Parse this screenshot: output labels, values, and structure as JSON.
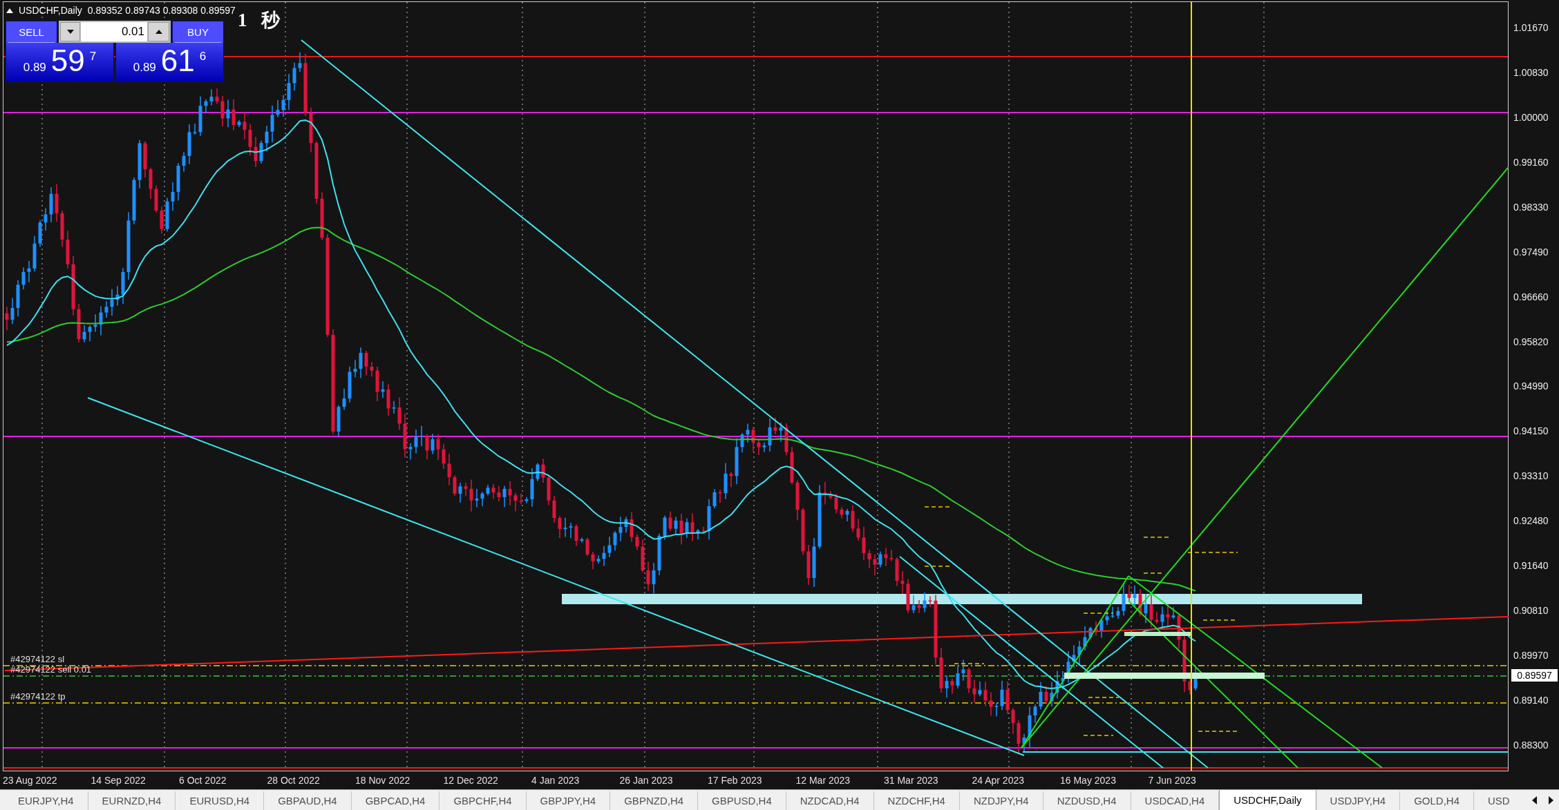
{
  "chart": {
    "symbol": "USDCHF,Daily",
    "quote": "0.89352 0.89743 0.89308 0.89597",
    "timer": "1 秒"
  },
  "one_click_trading": {
    "sell": {
      "label": "SELL",
      "price_prefix": "0.89",
      "price_pips": "59",
      "price_fraction": "7"
    },
    "lot": "0.01",
    "buy": {
      "label": "BUY",
      "price_prefix": "0.89",
      "price_pips": "61",
      "price_fraction": "6"
    }
  },
  "order_lines": [
    {
      "label": "#42974122 sl",
      "kind": "sl"
    },
    {
      "label": "#42974122 sell 0.01",
      "kind": "open"
    },
    {
      "label": "#42974122 tp",
      "kind": "tp"
    }
  ],
  "price_axis": {
    "labels": [
      "1.01670",
      "1.00830",
      "1.00000",
      "0.99160",
      "0.98330",
      "0.97490",
      "0.96660",
      "0.95820",
      "0.94990",
      "0.94150",
      "0.93310",
      "0.92480",
      "0.91640",
      "0.90810",
      "0.89970",
      "0.89140",
      "0.88300"
    ],
    "current_price": "0.89597"
  },
  "time_axis": {
    "labels": [
      "23 Aug 2022",
      "14 Sep 2022",
      "6 Oct 2022",
      "28 Oct 2022",
      "18 Nov 2022",
      "12 Dec 2022",
      "4 Jan 2023",
      "26 Jan 2023",
      "17 Feb 2023",
      "12 Mar 2023",
      "31 Mar 2023",
      "24 Apr 2023",
      "16 May 2023",
      "7 Jun 2023"
    ]
  },
  "tabs": [
    {
      "label": "EURJPY,H4",
      "selected": false
    },
    {
      "label": "EURNZD,H4",
      "selected": false
    },
    {
      "label": "EURUSD,H4",
      "selected": false
    },
    {
      "label": "GBPAUD,H4",
      "selected": false
    },
    {
      "label": "GBPCAD,H4",
      "selected": false
    },
    {
      "label": "GBPCHF,H4",
      "selected": false
    },
    {
      "label": "GBPJPY,H4",
      "selected": false
    },
    {
      "label": "GBPNZD,H4",
      "selected": false
    },
    {
      "label": "GBPUSD,H4",
      "selected": false
    },
    {
      "label": "NZDCAD,H4",
      "selected": false
    },
    {
      "label": "NZDCHF,H4",
      "selected": false
    },
    {
      "label": "NZDJPY,H4",
      "selected": false
    },
    {
      "label": "NZDUSD,H4",
      "selected": false
    },
    {
      "label": "USDCAD,H4",
      "selected": false
    },
    {
      "label": "USDCHF,Daily",
      "selected": true
    },
    {
      "label": "USDJPY,H4",
      "selected": false
    },
    {
      "label": "GOLD,H4",
      "selected": false
    },
    {
      "label": "USD",
      "selected": false
    }
  ]
}
